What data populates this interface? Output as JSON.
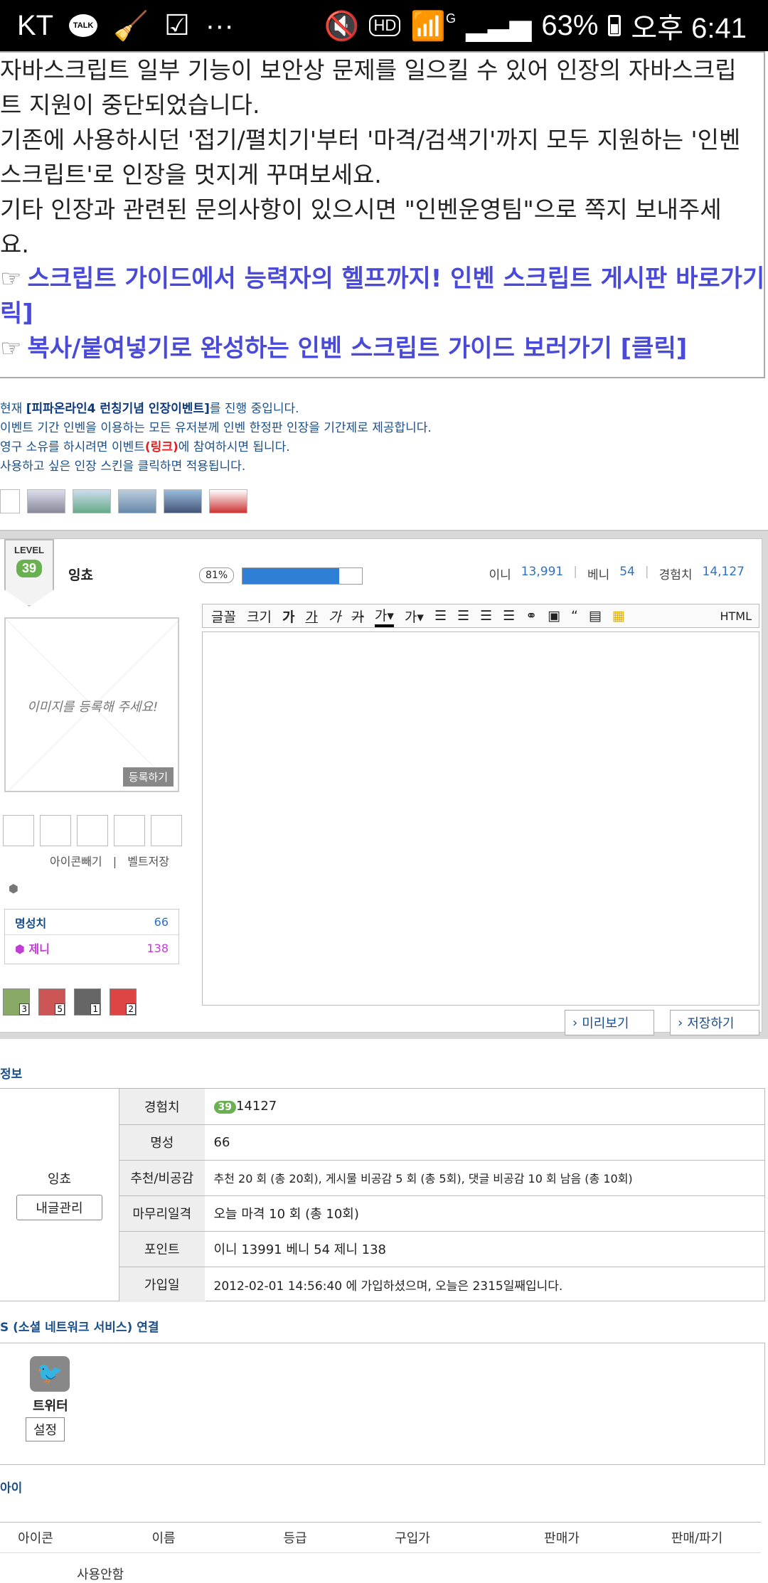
{
  "status": {
    "carrier": "KT",
    "talk": "TALK",
    "dots": "···",
    "hd": "HD",
    "net": "G",
    "battery": "63%",
    "time": "오후 6:41"
  },
  "notice": {
    "lines": [
      "자바스크립트 일부 기능이 보안상 문제를 일으킬 수 있어 인장의 자바스크립",
      "트 지원이 중단되었습니다.",
      "기존에 사용하시던 '접기/펼치기'부터 '마격/검색기'까지 모두 지원하는 '인벤",
      "스크립트'로 인장을 멋지게 꾸며보세요.",
      "기타 인장과 관련된 문의사항이 있으시면 \"인벤운영팀\"으로 쪽지 보내주세",
      "요."
    ],
    "link1a": "스크립트 가이드에서 능력자의 헬프까지! 인벤 스크립트 게시판 바로가기 [클",
    "link1b": "릭]",
    "link2": "복사/붙여넣기로 완성하는 인벤 스크립트 가이드 보러가기 [클릭]"
  },
  "event": {
    "line1_a": "현재 ",
    "line1_b": "[피파온라인4 런칭기념 인장이벤트]",
    "line1_c": "를 진행 중입니다.",
    "line2": "이벤트 기간 인벤을 이용하는 모든 유저분께 인벤 한정판 인장을 기간제로 제공합니다.",
    "line3_a": "영구 소유를 하시려면 이벤트",
    "line3_b": "(링크)",
    "line3_c": "에 참여하시면 됩니다.",
    "line4": "사용하고 싶은 인장 스킨을 클릭하면 적용됩니다."
  },
  "profile": {
    "level_label": "LEVEL",
    "level": "39",
    "nickname": "잉쵸",
    "progress_label": "81%",
    "progress": 0.81,
    "inni_label": "이니",
    "inni": "13,991",
    "benny_label": "베니",
    "benny": "54",
    "exp_label": "경험치",
    "exp": "14,127"
  },
  "toolbar": {
    "font": "글꼴",
    "size": "크기",
    "b": "가",
    "u": "가",
    "i": "가",
    "s": "가",
    "color": "가",
    "bg": "가",
    "html": "HTML"
  },
  "left": {
    "img_placeholder": "이미지를 등록해 주세요!",
    "register": "등록하기",
    "icon_remove": "아이콘빼기",
    "belt_save": "벨트저장",
    "fame_label": "명성치",
    "fame": "66",
    "zeni_label": "제니",
    "zeni": "138",
    "items": [
      "3",
      "5",
      "1",
      "2"
    ]
  },
  "buttons": {
    "preview": "미리보기",
    "save": "저장하기"
  },
  "info": {
    "section": "정보",
    "name": "잉쵸",
    "manage": "내글관리",
    "rows": [
      {
        "k": "경험치",
        "v": "14127"
      },
      {
        "k": "명성",
        "v": "66"
      },
      {
        "k": "추천/비공감",
        "v": "추천 20 회 (총 20회), 게시물 비공감 5 회 (총 5회), 댓글 비공감 10 회 남음 (총 10회)"
      },
      {
        "k": "마무리일격",
        "v": "오늘 마격 10 회 (총 10회)"
      },
      {
        "k": "포인트",
        "v": "이니 13991   베니 54   제니 138"
      },
      {
        "k": "가입일",
        "v": "2012-02-01 14:56:40 에 가입하셨으며, 오늘은 2315일째입니다."
      }
    ]
  },
  "sns": {
    "section": "S (소셜 네트워크 서비스) 연결",
    "twitter": "트위터",
    "setting": "설정"
  },
  "items_section": {
    "section": "아이",
    "headers": [
      "아이콘",
      "이름",
      "등급",
      "구입가",
      "판매가",
      "판매/파기"
    ],
    "first_row": "사용안함"
  }
}
